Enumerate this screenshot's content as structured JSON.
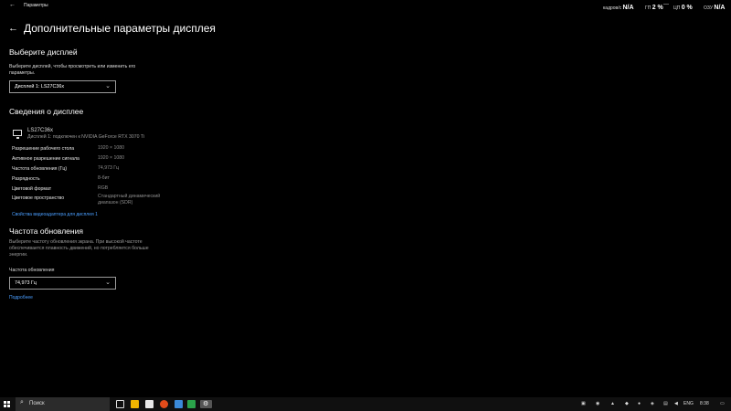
{
  "window": {
    "app_title": "Параметры",
    "back_glyph": "←",
    "controls": [
      "—",
      "☐",
      "✕"
    ]
  },
  "overlay": {
    "fps_label": "кадров/с",
    "fps_value": "N/A",
    "gpu_label": "ГП",
    "gpu_value": "2 %",
    "cpu_label": "ЦП",
    "cpu_value": "0 %",
    "ram_label": "ОЗУ",
    "ram_value": "N/A"
  },
  "page": {
    "title": "Дополнительные параметры дисплея",
    "select_display": {
      "heading": "Выберите дисплей",
      "description_line1": "Выберите дисплей, чтобы просмотреть или изменить его",
      "description_line2": "параметры.",
      "dropdown_value": "Дисплей 1: LS27C36x"
    },
    "display_info": {
      "heading": "Сведения о дисплее",
      "monitor_name": "LS27C36x",
      "monitor_sub": "Дисплей 1: подключен к NVIDIA GeForce RTX 3070 Ti",
      "rows": [
        {
          "label": "Разрешение рабочего стола",
          "value": "1920 × 1080"
        },
        {
          "label": "Активное разрешение сигнала",
          "value": "1920 × 1080"
        },
        {
          "label": "Частота обновления (Гц)",
          "value": "74,973 Гц"
        },
        {
          "label": "Разрядность",
          "value": "8-бит"
        },
        {
          "label": "Цветовой формат",
          "value": "RGB"
        },
        {
          "label": "Цветовое пространство",
          "value": "Стандартный динамический",
          "value2": "диапазон (SDR)"
        }
      ],
      "adapter_link": "Свойства видеоадаптера для дисплея 1"
    },
    "refresh": {
      "heading": "Частота обновления",
      "description_line1": "Выберите частоту обновления экрана. При высокой частоте",
      "description_line2": "обеспечивается плавность движений, но потребляется больше",
      "description_line3": "энергии.",
      "field_label": "Частота обновления",
      "dropdown_value": "74,973 Гц",
      "more_link": "Подробнее"
    }
  },
  "taskbar": {
    "search_placeholder": "Поиск",
    "language": "ENG",
    "time": "8:38",
    "app_colors": [
      "#d9d9d9",
      "#f0b400",
      "#e8e8e8",
      "#e24b1a",
      "#3b8ad9",
      "#2aa34a",
      "#7a7a7a",
      "#5b5b5b"
    ]
  }
}
